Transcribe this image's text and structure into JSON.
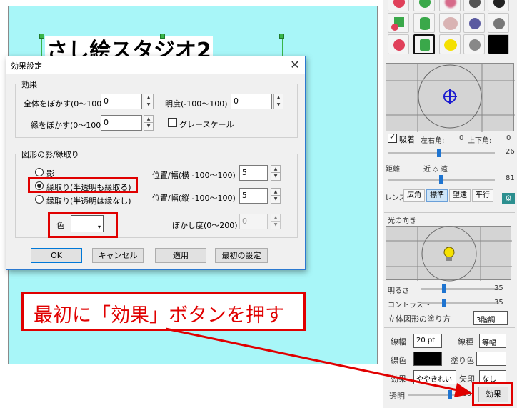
{
  "canvas": {
    "text": "さし絵スタジオ2"
  },
  "dialog": {
    "title": "効果設定",
    "close_glyph": "✕",
    "effect_group": {
      "title": "効果",
      "blur_all_label": "全体をぼかす(0〜100)",
      "blur_all_value": "0",
      "brightness_label": "明度(-100〜100)",
      "brightness_value": "0",
      "blur_edge_label": "縁をぼかす(0〜100)",
      "blur_edge_value": "0",
      "grayscale_label": "グレースケール"
    },
    "shadow_group": {
      "title": "図形の影/縁取り",
      "radio_shadow": "影",
      "radio_outline_translucent": "縁取り(半透明も縁取る)",
      "radio_outline_opaque": "縁取り(半透明は縁なし)",
      "pos_h_label": "位置/幅(横 -100〜100)",
      "pos_h_value": "5",
      "pos_v_label": "位置/幅(縦 -100〜100)",
      "pos_v_value": "5",
      "color_label": "色",
      "blur_label": "ぼかし度(0〜200)",
      "blur_value": "0"
    },
    "buttons": {
      "ok": "OK",
      "cancel": "キャンセル",
      "apply": "適用",
      "reset": "最初の設定"
    }
  },
  "callout": {
    "text": "最初に「効果」ボタンを押す"
  },
  "panel": {
    "camera": {
      "attach_label": "吸着",
      "left_right_label": "左右角:",
      "left_right_value": "0",
      "up_down_label": "上下角:",
      "up_down_value": "0",
      "slider1_value": "26",
      "distance_label": "距離",
      "near_far_label": "近 ◇ 遠",
      "distance_value": "81",
      "lens_label": "レンズ",
      "lens_options": [
        "広角",
        "標準",
        "望遠",
        "平行"
      ],
      "lens_selected": "標準"
    },
    "light": {
      "title": "光の向き",
      "brightness_label": "明るさ",
      "brightness_value": "35",
      "contrast_label": "コントラスト",
      "contrast_value": "35",
      "fill_label": "立体図形の塗り方",
      "fill_value": "3階調"
    },
    "line": {
      "width_label": "線幅",
      "width_value": "20 pt",
      "type_label": "線種",
      "type_value": "等幅",
      "line_color_label": "線色",
      "fill_color_label": "塗り色",
      "effect_label": "効果",
      "effect_value": "ややきれい",
      "arrow_label": "矢印",
      "arrow_value": "なし",
      "opacity_label": "透明",
      "opacity_value": "100",
      "effect_button": "効果"
    }
  },
  "colors": {
    "accent_red": "#e00000",
    "canvas_bg": "#a8f6f8",
    "selection_green": "#39b54a"
  }
}
